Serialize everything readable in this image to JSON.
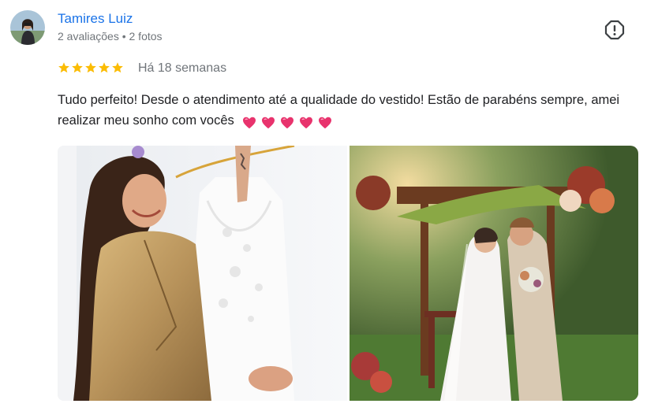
{
  "review": {
    "author_name": "Tamires Luiz",
    "author_meta": "2 avaliações • 2 fotos",
    "rating": 5,
    "rating_max": 5,
    "time_ago": "Há 18 semanas",
    "text": "Tudo perfeito! Desde o atendimento até a qualidade do vestido! Estão de parabéns sempre, amei realizar meu sonho com vocês",
    "emoji_count": 5
  },
  "colors": {
    "author_link": "#1a73e8",
    "meta_text": "#70757a",
    "body_text": "#202124",
    "star": "#fbbc04",
    "heart": "#e8336d"
  },
  "icons": {
    "report": "report-flag-icon",
    "star": "star-icon",
    "heart": "heart-emoji-icon"
  }
}
